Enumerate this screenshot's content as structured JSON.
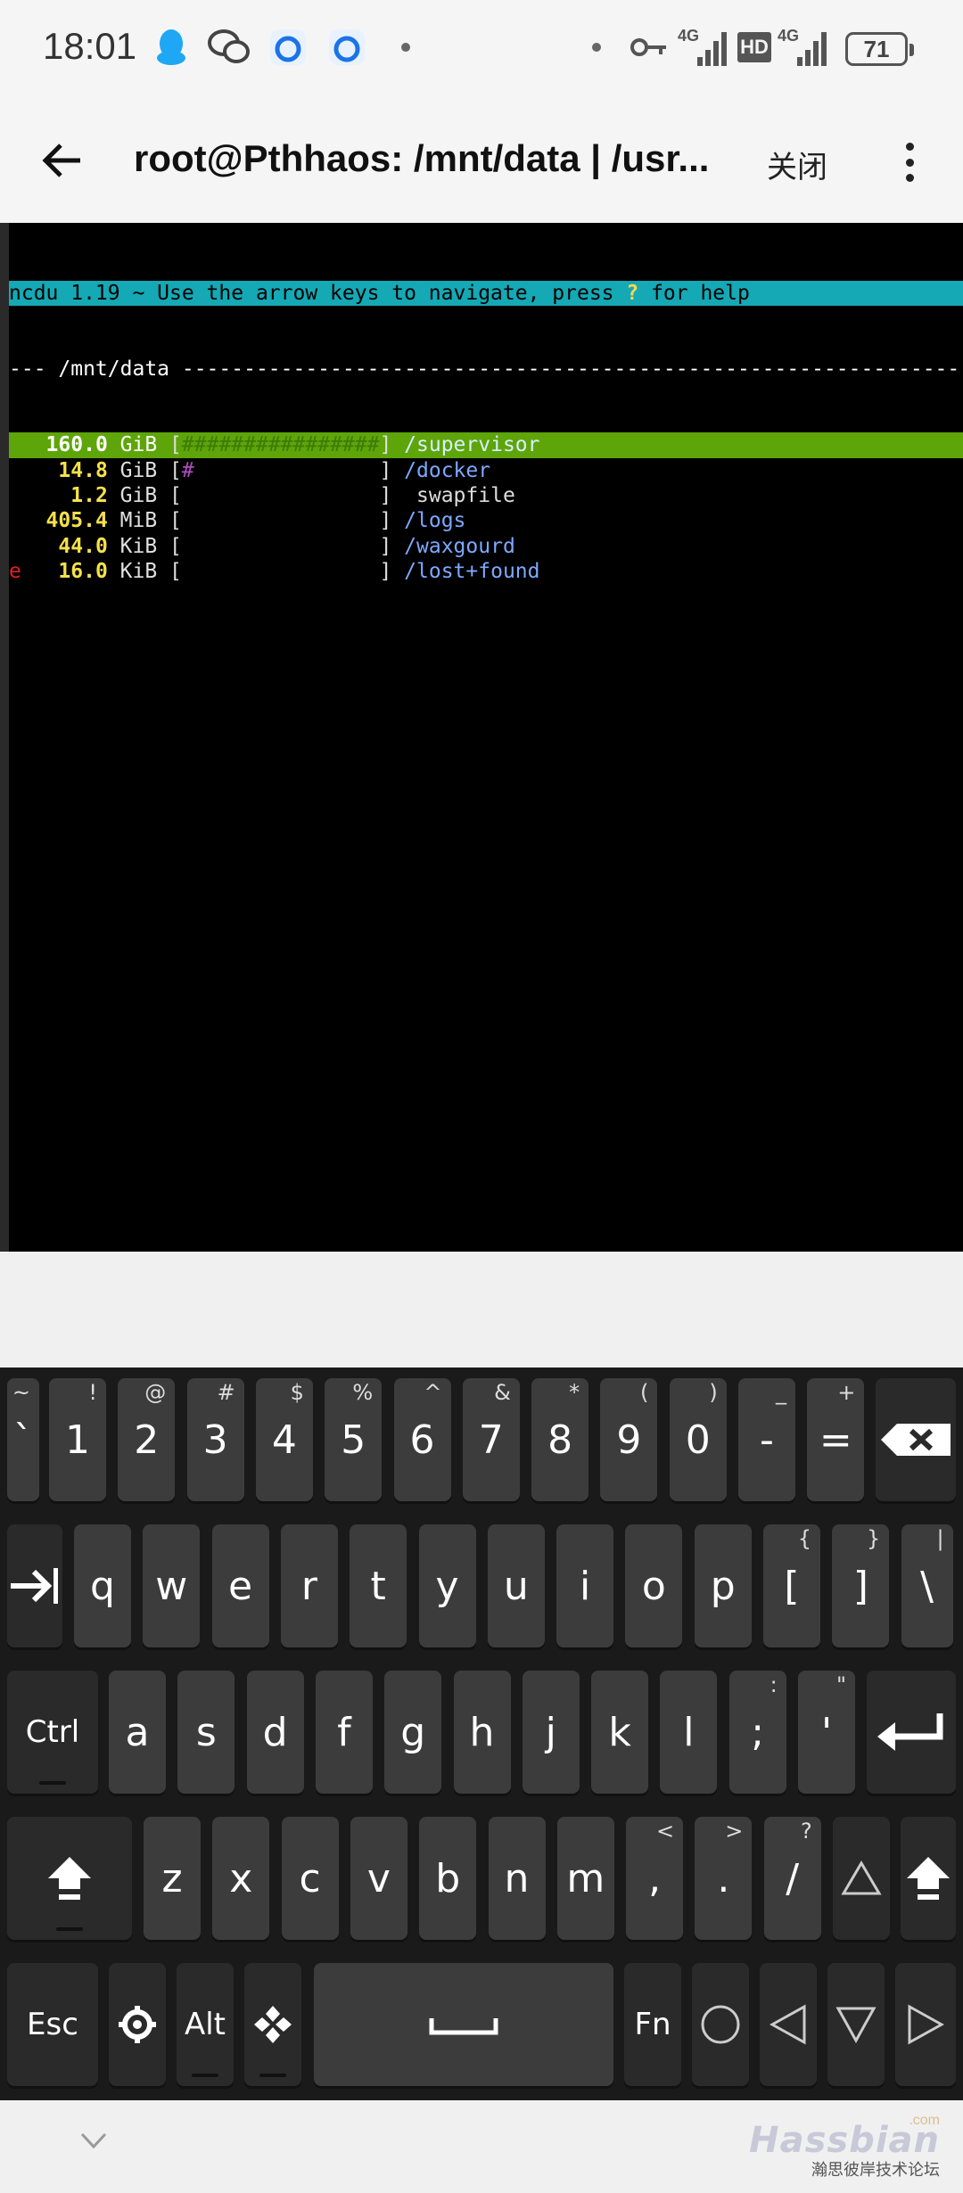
{
  "status_bar": {
    "time": "18:01",
    "battery": "71",
    "icons": [
      "qq-icon",
      "wechat-icon",
      "browser-icon",
      "browser-icon",
      "dot-icon",
      "dot-icon",
      "vpn-key-icon",
      "signal-4g-icon",
      "hd-icon",
      "signal-4g-icon",
      "battery-icon"
    ],
    "net_label_1": "4G",
    "net_label_2": "4G",
    "hd_label": "HD"
  },
  "app_bar": {
    "title": "root@Pthhaos: /mnt/data | /usr...",
    "close_label": "关闭"
  },
  "terminal": {
    "header": {
      "pre": "ncdu 1.19 ~ Use the arrow keys to navigate, press ",
      "q": "?",
      "post": " for help"
    },
    "dir_line": "--- /mnt/data ---------------------------------------------------------------------",
    "rows": [
      {
        "flag": " ",
        "size": "  160.0",
        "unit": " GiB ",
        "open": "[",
        "bar": "################",
        "close": "] ",
        "name": "/supervisor",
        "kind": "dir",
        "selected": true
      },
      {
        "flag": " ",
        "size": "   14.8",
        "unit": " GiB ",
        "open": "[",
        "bar": "#               ",
        "close": "] ",
        "name": "/docker",
        "kind": "dir",
        "selected": false
      },
      {
        "flag": " ",
        "size": "    1.2",
        "unit": " GiB ",
        "open": "[",
        "bar": "                ",
        "close": "] ",
        "name": " swapfile",
        "kind": "file",
        "selected": false
      },
      {
        "flag": " ",
        "size": "  405.4",
        "unit": " MiB ",
        "open": "[",
        "bar": "                ",
        "close": "] ",
        "name": "/logs",
        "kind": "dir",
        "selected": false
      },
      {
        "flag": " ",
        "size": "   44.0",
        "unit": " KiB ",
        "open": "[",
        "bar": "                ",
        "close": "] ",
        "name": "/waxgourd",
        "kind": "dir",
        "selected": false
      },
      {
        "flag": "e",
        "size": "   16.0",
        "unit": " KiB ",
        "open": "[",
        "bar": "                ",
        "close": "] ",
        "name": "/lost+found",
        "kind": "dir",
        "selected": false
      }
    ]
  },
  "keyboard": {
    "row1": [
      {
        "main": "`",
        "sub": "~"
      },
      {
        "main": "1",
        "sub": "!"
      },
      {
        "main": "2",
        "sub": "@"
      },
      {
        "main": "3",
        "sub": "#"
      },
      {
        "main": "4",
        "sub": "$"
      },
      {
        "main": "5",
        "sub": "%"
      },
      {
        "main": "6",
        "sub": "^"
      },
      {
        "main": "7",
        "sub": "&"
      },
      {
        "main": "8",
        "sub": "*"
      },
      {
        "main": "9",
        "sub": "("
      },
      {
        "main": "0",
        "sub": ")"
      },
      {
        "main": "-",
        "sub": "_"
      },
      {
        "main": "=",
        "sub": "+"
      }
    ],
    "row2": [
      {
        "main": "q",
        "sub": ""
      },
      {
        "main": "w",
        "sub": ""
      },
      {
        "main": "e",
        "sub": ""
      },
      {
        "main": "r",
        "sub": ""
      },
      {
        "main": "t",
        "sub": ""
      },
      {
        "main": "y",
        "sub": ""
      },
      {
        "main": "u",
        "sub": ""
      },
      {
        "main": "i",
        "sub": ""
      },
      {
        "main": "o",
        "sub": ""
      },
      {
        "main": "p",
        "sub": ""
      },
      {
        "main": "[",
        "sub": "{"
      },
      {
        "main": "]",
        "sub": "}"
      },
      {
        "main": "\\",
        "sub": "|"
      }
    ],
    "row3": [
      {
        "main": "a",
        "sub": ""
      },
      {
        "main": "s",
        "sub": ""
      },
      {
        "main": "d",
        "sub": ""
      },
      {
        "main": "f",
        "sub": ""
      },
      {
        "main": "g",
        "sub": ""
      },
      {
        "main": "h",
        "sub": ""
      },
      {
        "main": "j",
        "sub": ""
      },
      {
        "main": "k",
        "sub": ""
      },
      {
        "main": "l",
        "sub": ""
      },
      {
        "main": ";",
        "sub": ":"
      },
      {
        "main": "'",
        "sub": "\""
      }
    ],
    "row4": [
      {
        "main": "z",
        "sub": ""
      },
      {
        "main": "x",
        "sub": ""
      },
      {
        "main": "c",
        "sub": ""
      },
      {
        "main": "v",
        "sub": ""
      },
      {
        "main": "b",
        "sub": ""
      },
      {
        "main": "n",
        "sub": ""
      },
      {
        "main": "m",
        "sub": ""
      },
      {
        "main": ",",
        "sub": "<"
      },
      {
        "main": ".",
        "sub": ">"
      },
      {
        "main": "/",
        "sub": "?"
      }
    ],
    "ctrl_label": "Ctrl",
    "esc_label": "Esc",
    "alt_label": "Alt",
    "fn_label": "Fn"
  },
  "nav_bar": {
    "watermark_main": "Hassbian",
    "watermark_com": ".com",
    "watermark_sub": "瀚思彼岸技术论坛"
  }
}
